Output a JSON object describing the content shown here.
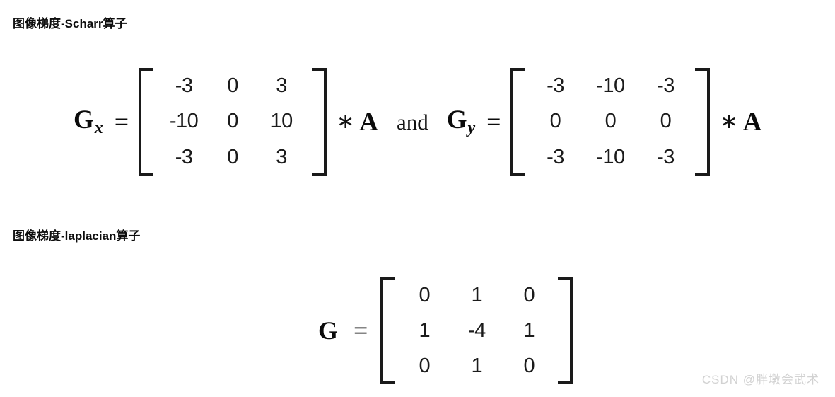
{
  "sections": [
    {
      "heading": "图像梯度-Scharr算子",
      "formula": {
        "lhs_x": {
          "symbol": "G",
          "subscript": "x"
        },
        "lhs_y": {
          "symbol": "G",
          "subscript": "y"
        },
        "equals": "=",
        "conv_operator": "∗",
        "operand": "A",
        "conjunction": "and",
        "matrix_x": {
          "rows": [
            [
              "-3",
              "0",
              "3"
            ],
            [
              "-10",
              "0",
              "10"
            ],
            [
              "-3",
              "0",
              "3"
            ]
          ]
        },
        "matrix_y": {
          "rows": [
            [
              "-3",
              "-10",
              "-3"
            ],
            [
              "0",
              "0",
              "0"
            ],
            [
              "-3",
              "-10",
              "-3"
            ]
          ]
        }
      }
    },
    {
      "heading": "图像梯度-laplacian算子",
      "formula": {
        "lhs": {
          "symbol": "G"
        },
        "equals": "=",
        "matrix": {
          "rows": [
            [
              "0",
              "1",
              "0"
            ],
            [
              "1",
              "-4",
              "1"
            ],
            [
              "0",
              "1",
              "0"
            ]
          ]
        }
      }
    }
  ],
  "watermark": "CSDN @胖墩会武术",
  "colors": {
    "background": "#ffffff",
    "text": "#0b0b0b",
    "matrix_number": "#1b1b1b",
    "bracket": "#1a1a1a",
    "watermark": "#d2d2d2"
  }
}
